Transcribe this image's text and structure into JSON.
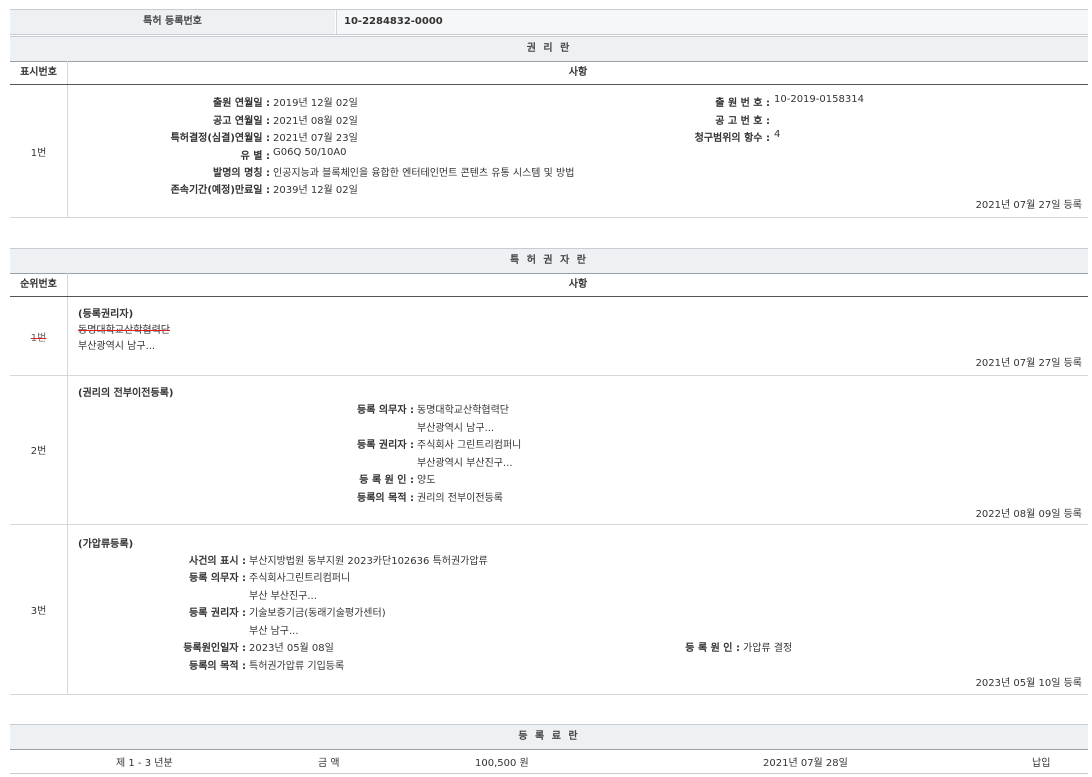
{
  "top": {
    "label": "특허 등록번호",
    "value": "10-2284832-0000"
  },
  "rights_section": {
    "title": "권 리 란",
    "col_num": "표시번호",
    "col_item": "사항",
    "row": {
      "num": "1번",
      "app_date_label": "출원 연월일",
      "app_date": "2019년 12월 02일",
      "pub_date_label": "공고 연월일",
      "pub_date": "2021년 08월 02일",
      "decision_date_label": "특허결정(심결)연월일",
      "decision_date": "2021년 07월 23일",
      "class_label": "유 별",
      "class_value": "G06Q 50/10A0",
      "title_label": "발명의 명칭",
      "title_value": "인공지능과 블록체인을 융합한 엔터테인먼트 콘텐츠 유통 시스템 및 방법",
      "expiry_label": "존속기간(예정)만료일",
      "expiry_value": "2039년 12월 02일",
      "app_no_label": "출 원 번 호",
      "app_no": "10-2019-0158314",
      "pub_no_label": "공 고 번 호",
      "pub_no": "",
      "claims_label": "청구범위의 항수",
      "claims": "4",
      "reg_date": "2021년 07월 27일 등록"
    }
  },
  "owner_section": {
    "title": "특 허 권 자 란",
    "col_num": "순위번호",
    "col_item": "사항",
    "rows": [
      {
        "num": "1번",
        "type": "(등록권리자)",
        "name": "동명대학교산학협력단",
        "addr": "부산광역시 남구...",
        "reg_date": "2021년 07월 27일 등록"
      },
      {
        "num": "2번",
        "type": "(권리의 전부이전등록)",
        "obligor_label": "등록 의무자",
        "obligor": "동명대학교산학협력단",
        "obligor_addr": "부산광역시 남구...",
        "holder_label": "등록 권리자",
        "holder": "주식회사 그린트리컴퍼니",
        "holder_addr": "부산광역시 부산진구...",
        "cause_label": "등 록 원 인",
        "cause": "양도",
        "purpose_label": "등록의 목적",
        "purpose": "권리의 전부이전등록",
        "reg_date": "2022년 08월 09일 등록"
      },
      {
        "num": "3번",
        "type": "(가압류등록)",
        "case_label": "사건의 표시",
        "case": "부산지방법원 동부지원 2023카단102636 특허권가압류",
        "obligor_label": "등록 의무자",
        "obligor": "주식회사그린트리컴퍼니",
        "obligor_addr": "부산 부산진구...",
        "holder_label": "등록 권리자",
        "holder": "기술보증기금(동래기술평가센터)",
        "holder_addr": "부산 남구...",
        "cause_date_label": "등록원인일자",
        "cause_date": "2023년 05월 08일",
        "cause_label": "등 록 원 인",
        "cause": "가압류 결정",
        "purpose_label": "등록의 목적",
        "purpose": "특허권가압류 기입등록",
        "reg_date": "2023년 05월 10일 등록"
      }
    ]
  },
  "fee_section": {
    "title": "등 록 료 란",
    "period": "제 1 - 3 년분",
    "amount_label": "금 액",
    "amount": "100,500 원",
    "date": "2021년 07월 28일",
    "status": "납입"
  }
}
